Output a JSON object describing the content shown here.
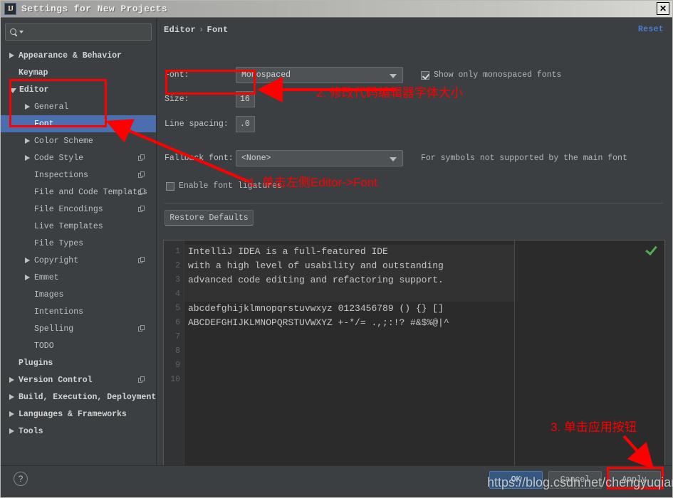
{
  "window": {
    "title": "Settings for New Projects",
    "logo_text": "IJ",
    "close_label": "✕"
  },
  "sidebar": {
    "search_placeholder": "",
    "search_value": "",
    "search_icon": "search-icon",
    "items": [
      {
        "label": "Appearance & Behavior",
        "arrow": "right",
        "indent": 0,
        "bold": true,
        "selected": false,
        "copy": false
      },
      {
        "label": "Keymap",
        "arrow": "none",
        "indent": 0,
        "bold": true,
        "selected": false,
        "copy": false
      },
      {
        "label": "Editor",
        "arrow": "down",
        "indent": 0,
        "bold": true,
        "selected": false,
        "copy": false
      },
      {
        "label": "General",
        "arrow": "right",
        "indent": 1,
        "bold": false,
        "selected": false,
        "copy": false
      },
      {
        "label": "Font",
        "arrow": "none",
        "indent": 1,
        "bold": false,
        "selected": true,
        "copy": false
      },
      {
        "label": "Color Scheme",
        "arrow": "right",
        "indent": 1,
        "bold": false,
        "selected": false,
        "copy": false
      },
      {
        "label": "Code Style",
        "arrow": "right",
        "indent": 1,
        "bold": false,
        "selected": false,
        "copy": true
      },
      {
        "label": "Inspections",
        "arrow": "none",
        "indent": 1,
        "bold": false,
        "selected": false,
        "copy": true
      },
      {
        "label": "File and Code Templates",
        "arrow": "none",
        "indent": 1,
        "bold": false,
        "selected": false,
        "copy": true
      },
      {
        "label": "File Encodings",
        "arrow": "none",
        "indent": 1,
        "bold": false,
        "selected": false,
        "copy": true
      },
      {
        "label": "Live Templates",
        "arrow": "none",
        "indent": 1,
        "bold": false,
        "selected": false,
        "copy": false
      },
      {
        "label": "File Types",
        "arrow": "none",
        "indent": 1,
        "bold": false,
        "selected": false,
        "copy": false
      },
      {
        "label": "Copyright",
        "arrow": "right",
        "indent": 1,
        "bold": false,
        "selected": false,
        "copy": true
      },
      {
        "label": "Emmet",
        "arrow": "right",
        "indent": 1,
        "bold": false,
        "selected": false,
        "copy": false
      },
      {
        "label": "Images",
        "arrow": "none",
        "indent": 1,
        "bold": false,
        "selected": false,
        "copy": false
      },
      {
        "label": "Intentions",
        "arrow": "none",
        "indent": 1,
        "bold": false,
        "selected": false,
        "copy": false
      },
      {
        "label": "Spelling",
        "arrow": "none",
        "indent": 1,
        "bold": false,
        "selected": false,
        "copy": true
      },
      {
        "label": "TODO",
        "arrow": "none",
        "indent": 1,
        "bold": false,
        "selected": false,
        "copy": false
      },
      {
        "label": "Plugins",
        "arrow": "none",
        "indent": 0,
        "bold": true,
        "selected": false,
        "copy": false
      },
      {
        "label": "Version Control",
        "arrow": "right",
        "indent": 0,
        "bold": true,
        "selected": false,
        "copy": true
      },
      {
        "label": "Build, Execution, Deployment",
        "arrow": "right",
        "indent": 0,
        "bold": true,
        "selected": false,
        "copy": false
      },
      {
        "label": "Languages & Frameworks",
        "arrow": "right",
        "indent": 0,
        "bold": true,
        "selected": false,
        "copy": false
      },
      {
        "label": "Tools",
        "arrow": "right",
        "indent": 0,
        "bold": true,
        "selected": false,
        "copy": false
      }
    ]
  },
  "main": {
    "breadcrumb_root": "Editor",
    "breadcrumb_sep": "›",
    "breadcrumb_leaf": "Font",
    "reset_label": "Reset",
    "font_label": "Font:",
    "font_value": "Monospaced",
    "show_monospaced_label": "Show only monospaced fonts",
    "show_monospaced_checked": true,
    "size_label": "Size:",
    "size_value": "16",
    "line_spacing_label": "Line spacing:",
    "line_spacing_value": ".0",
    "fallback_label": "Fallback font:",
    "fallback_value": "<None>",
    "fallback_hint": "For symbols not supported by the main font",
    "ligatures_label": "Enable font ligatures",
    "ligatures_checked": false,
    "restore_defaults_label": "Restore Defaults"
  },
  "preview": {
    "line_numbers": [
      "1",
      "2",
      "3",
      "4",
      "5",
      "6",
      "7",
      "8",
      "9",
      "10"
    ],
    "lines": [
      "IntelliJ IDEA is a full-featured IDE",
      "with a high level of usability and outstanding",
      "advanced code editing and refactoring support.",
      "",
      "abcdefghijklmnopqrstuvwxyz 0123456789 () {} []",
      "ABCDEFGHIJKLMNOPQRSTUVWXYZ +-*/= .,;:!? #&$%@|^",
      "",
      "",
      "",
      ""
    ],
    "status_icon": "green-check-icon"
  },
  "footer": {
    "help_label": "?",
    "ok_label": "OK",
    "cancel_label": "Cancel",
    "apply_label": "Apply"
  },
  "annotations": {
    "step1": "1. 单击左侧Editor->Font",
    "step2": "2. 修改代码编辑器字体大小",
    "step3": "3. 单击应用按钮",
    "color": "#ff0000"
  },
  "watermark": "https://blog.csdn.net/chengyuqiang"
}
